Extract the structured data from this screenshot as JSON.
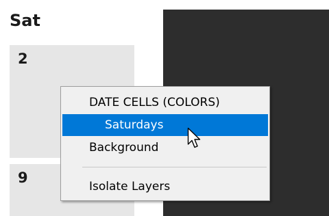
{
  "calendar": {
    "day_header": "Sat",
    "cells": [
      {
        "date": "2"
      },
      {
        "date": "9"
      }
    ]
  },
  "context_menu": {
    "header_label": "DATE CELLS (COLORS)",
    "items": [
      {
        "label": "Saturdays",
        "selected": true
      },
      {
        "label": "Background",
        "selected": false
      },
      {
        "label": "Isolate Layers",
        "selected": false
      }
    ]
  },
  "colors": {
    "selection": "#0078d7",
    "menu_background": "#f0f0f0",
    "cell_background": "#e6e6e6",
    "dark_panel": "#2d2d2d"
  },
  "cursor": {
    "icon": "mouse-pointer-icon"
  }
}
